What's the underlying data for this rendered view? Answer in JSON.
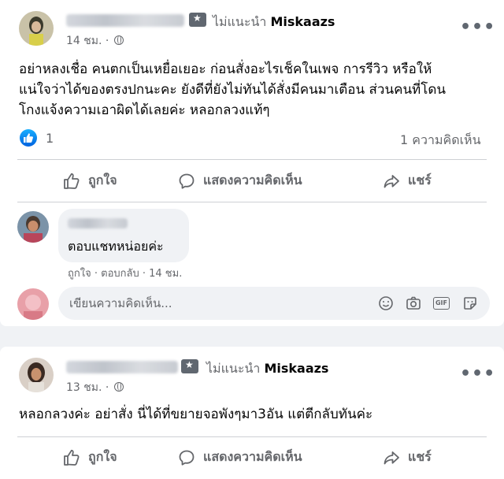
{
  "posts": [
    {
      "recommend_text": "ไม่แนะนำ",
      "page_name": "Miskaazs",
      "time": "14 ชม.",
      "text_lines": [
        "อย่าหลงเชื่อ คนตกเป็นเหยื่อเยอะ ก่อนสั่งอะไรเช็คในเพจ การรีวิว หรือให้",
        "แน่ใจว่าได้ของตรงปกนะคะ ยังดีที่ยังไม่ทันได้สั่งมีคนมาเตือน ส่วนคนที่โดน",
        "โกงแจ้งความเอาผิดได้เลยค่ะ หลอกลวงแท้ๆ"
      ],
      "reactions_count": "1",
      "comments_count": "1 ความคิดเห็น",
      "comment": {
        "text": "ตอบแชทหน่อยค่ะ",
        "like_label": "ถูกใจ",
        "reply_label": "ตอบกลับ",
        "separator": " · ",
        "time": "14 ชม."
      },
      "comment_placeholder": "เขียนความคิดเห็น..."
    },
    {
      "recommend_text": "ไม่แนะนำ",
      "page_name": "Miskaazs",
      "time": "13 ชม.",
      "text_lines": [
        "หลอกลวงค่ะ อย่าสั่ง นี่ได้ที่ขยายจอพังๆมา3อัน แต่ตีกลับทันค่ะ"
      ]
    }
  ],
  "actions": {
    "like": "ถูกใจ",
    "comment": "แสดงความคิดเห็น",
    "share": "แชร์"
  },
  "meta_separator": " · ",
  "more_symbol": "•••",
  "colors": {
    "accent": "#1877f2",
    "muted": "#65676b",
    "background": "#f0f2f5"
  }
}
